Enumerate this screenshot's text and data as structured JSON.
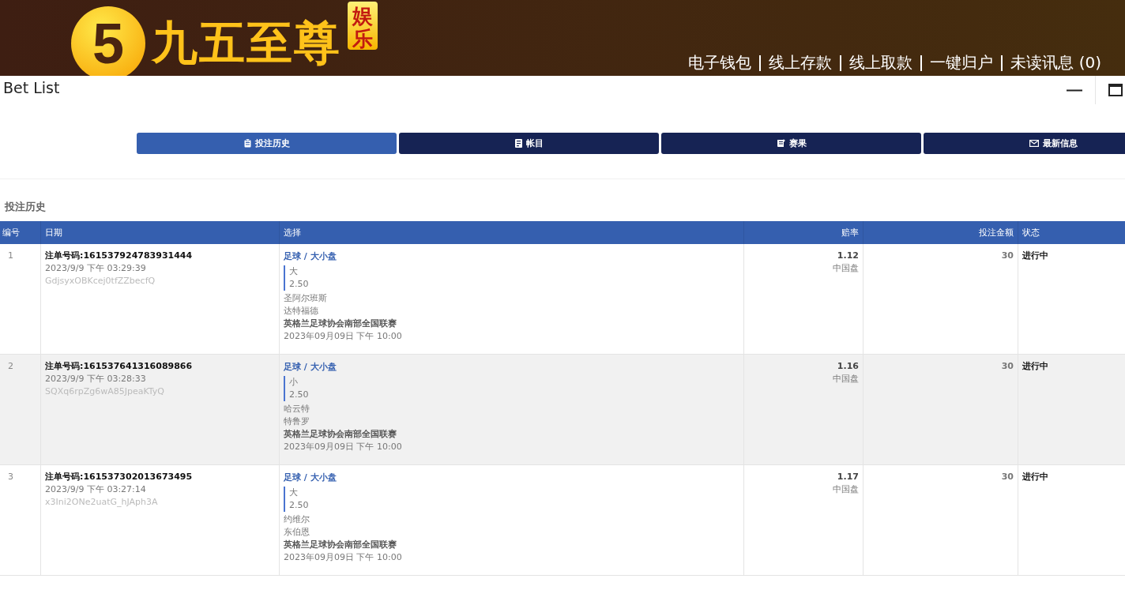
{
  "header": {
    "logo": {
      "mark": "5",
      "name": "九五至尊",
      "badge": "娱乐"
    },
    "nav": [
      "电子钱包",
      "线上存款",
      "线上取款",
      "一键归户",
      "未读讯息 (0)"
    ]
  },
  "window": {
    "title": "Bet List"
  },
  "tabs": [
    {
      "label": "投注历史",
      "kind": "history",
      "selected": true
    },
    {
      "label": "帐目",
      "kind": "account",
      "selected": false
    },
    {
      "label": "赛果",
      "kind": "results",
      "selected": false
    },
    {
      "label": "最新信息",
      "kind": "messages",
      "selected": false
    }
  ],
  "section_title": "投注历史",
  "table": {
    "columns": [
      "编号",
      "日期",
      "选择",
      "赔率",
      "投注金额",
      "状态"
    ],
    "rows": [
      {
        "index": "1",
        "order": "注单号码:161537924783931444",
        "datetime": "2023/9/9 下午 03:29:39",
        "code": "GdjsyxOBKcej0tfZZbecfQ",
        "market": "足球 / 大小盘",
        "pick": "大",
        "line": "2.50",
        "home": "圣阿尔班斯",
        "away": "达特福德",
        "league": "英格兰足球协会南部全国联赛",
        "match_time": "2023年09月09日 下午 10:00",
        "odds": "1.12",
        "odds_type": "中国盘",
        "amount": "30",
        "status": "进行中"
      },
      {
        "index": "2",
        "order": "注单号码:161537641316089866",
        "datetime": "2023/9/9 下午 03:28:33",
        "code": "SQXq6rpZg6wA85JpeaKTyQ",
        "market": "足球 / 大小盘",
        "pick": "小",
        "line": "2.50",
        "home": "哈云特",
        "away": "特鲁罗",
        "league": "英格兰足球协会南部全国联赛",
        "match_time": "2023年09月09日 下午 10:00",
        "odds": "1.16",
        "odds_type": "中国盘",
        "amount": "30",
        "status": "进行中"
      },
      {
        "index": "3",
        "order": "注单号码:161537302013673495",
        "datetime": "2023/9/9 下午 03:27:14",
        "code": "x3Ini2ONe2uatG_hJAph3A",
        "market": "足球 / 大小盘",
        "pick": "大",
        "line": "2.50",
        "home": "约维尔",
        "away": "东伯恩",
        "league": "英格兰足球协会南部全国联赛",
        "match_time": "2023年09月09日 下午 10:00",
        "odds": "1.17",
        "odds_type": "中国盘",
        "amount": "30",
        "status": "进行中"
      }
    ]
  }
}
